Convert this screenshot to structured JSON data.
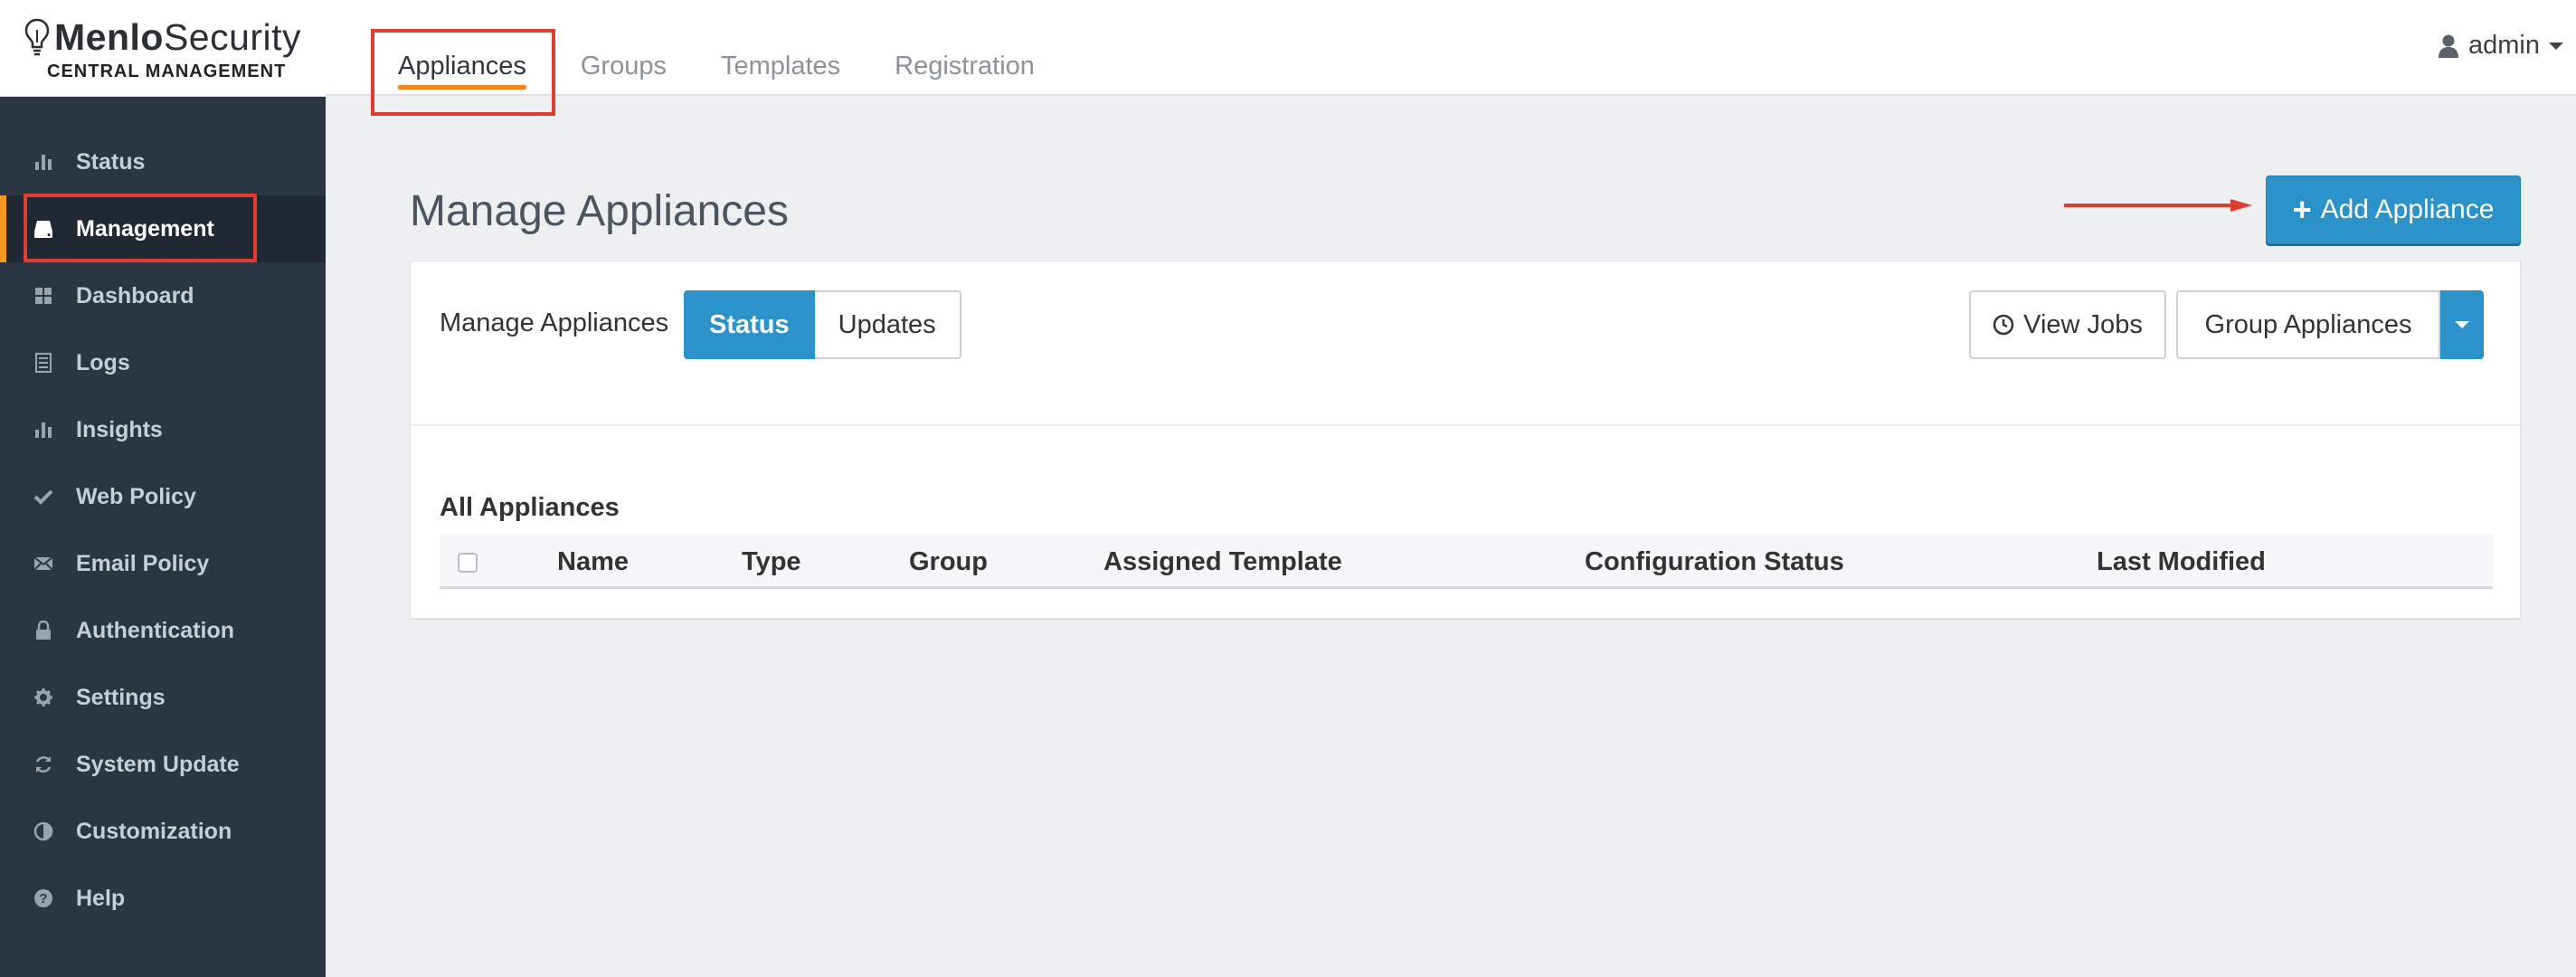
{
  "brand": {
    "name_bold": "Menlo",
    "name_regular": "Security",
    "subtitle": "CENTRAL MANAGEMENT"
  },
  "sidebar": {
    "items": [
      {
        "label": "Status",
        "icon": "bar-chart-icon"
      },
      {
        "label": "Management",
        "icon": "drive-icon",
        "active": true
      },
      {
        "label": "Dashboard",
        "icon": "grid-icon"
      },
      {
        "label": "Logs",
        "icon": "list-icon"
      },
      {
        "label": "Insights",
        "icon": "bar-chart-icon"
      },
      {
        "label": "Web Policy",
        "icon": "check-icon"
      },
      {
        "label": "Email Policy",
        "icon": "envelope-icon"
      },
      {
        "label": "Authentication",
        "icon": "lock-icon"
      },
      {
        "label": "Settings",
        "icon": "gear-icon"
      },
      {
        "label": "System Update",
        "icon": "refresh-icon"
      },
      {
        "label": "Customization",
        "icon": "contrast-icon"
      },
      {
        "label": "Help",
        "icon": "question-icon"
      }
    ]
  },
  "topnav": {
    "tabs": [
      {
        "label": "Appliances",
        "active": true
      },
      {
        "label": "Groups"
      },
      {
        "label": "Templates"
      },
      {
        "label": "Registration"
      }
    ],
    "user": "admin"
  },
  "page": {
    "title": "Manage Appliances",
    "add_button": "Add Appliance"
  },
  "panel": {
    "label": "Manage Appliances",
    "segments": [
      "Status",
      "Updates"
    ],
    "view_jobs": "View Jobs",
    "group_appliances": "Group Appliances",
    "section_title": "All Appliances",
    "columns": [
      "Name",
      "Type",
      "Group",
      "Assigned Template",
      "Configuration Status",
      "Last Modified"
    ]
  },
  "colors": {
    "accent": "#2b93c9",
    "sidebar_bg": "#2b3643",
    "active_marker": "#f59a23",
    "tab_underline": "#f5861f",
    "annotation_red": "#e03c31"
  }
}
